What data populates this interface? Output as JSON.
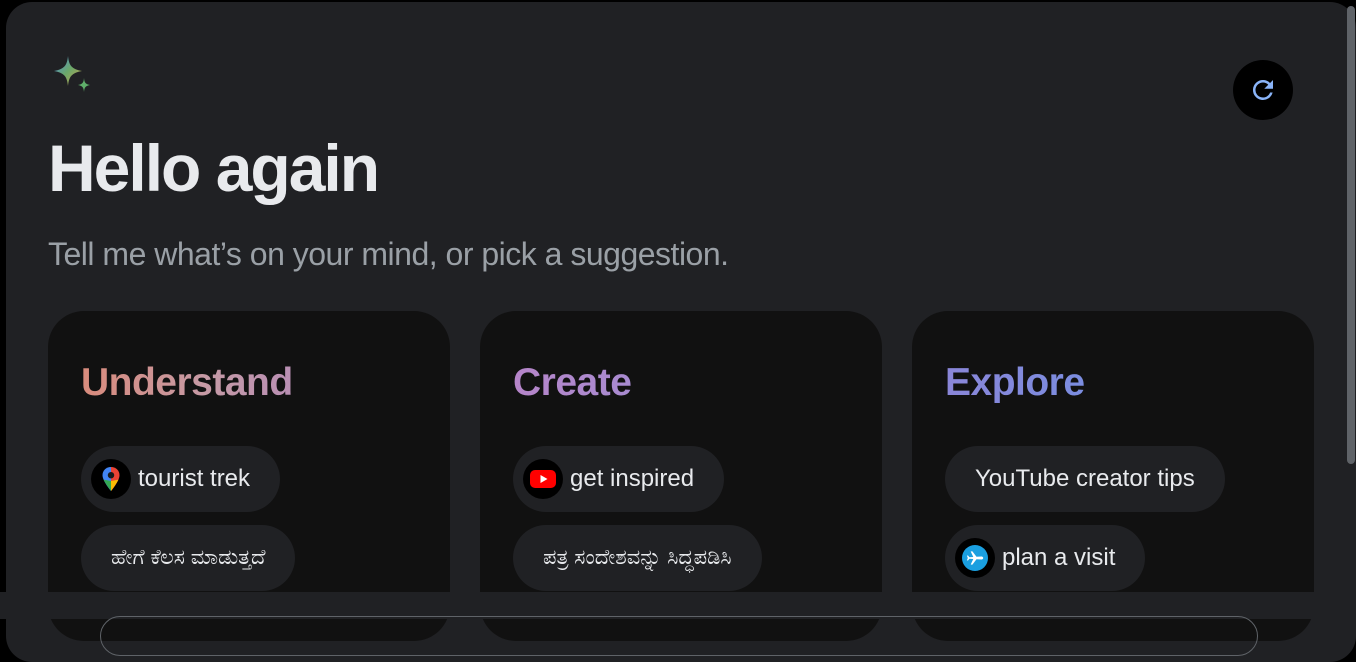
{
  "header": {
    "greeting": "Hello again",
    "subtitle": "Tell me what’s on your mind, or pick a suggestion.",
    "logo_icon": "gemini-sparkle-icon",
    "refresh_icon": "refresh-icon"
  },
  "cards": {
    "understand": {
      "title": "Understand",
      "chips": [
        {
          "label": "tourist trek",
          "icon": "google-maps-icon"
        },
        {
          "label": "ಹೇಗೆ ಕೆಲಸ ಮಾಡುತ್ತದೆ",
          "icon": null
        }
      ]
    },
    "create": {
      "title": "Create",
      "chips": [
        {
          "label": "get inspired",
          "icon": "youtube-icon"
        },
        {
          "label": "ಪತ್ರ ಸಂದೇಶವನ್ನು ಸಿದ್ಧಪಡಿಸಿ",
          "icon": null
        }
      ]
    },
    "explore": {
      "title": "Explore",
      "chips": [
        {
          "label": "YouTube creator tips",
          "icon": null
        },
        {
          "label": "plan a visit",
          "icon": "flights-icon"
        }
      ]
    }
  },
  "colors": {
    "background": "#202124",
    "card": "#111111",
    "understand_accent": "#d98b7c",
    "create_accent": "#b685c9",
    "explore_accent": "#7b8de0"
  }
}
